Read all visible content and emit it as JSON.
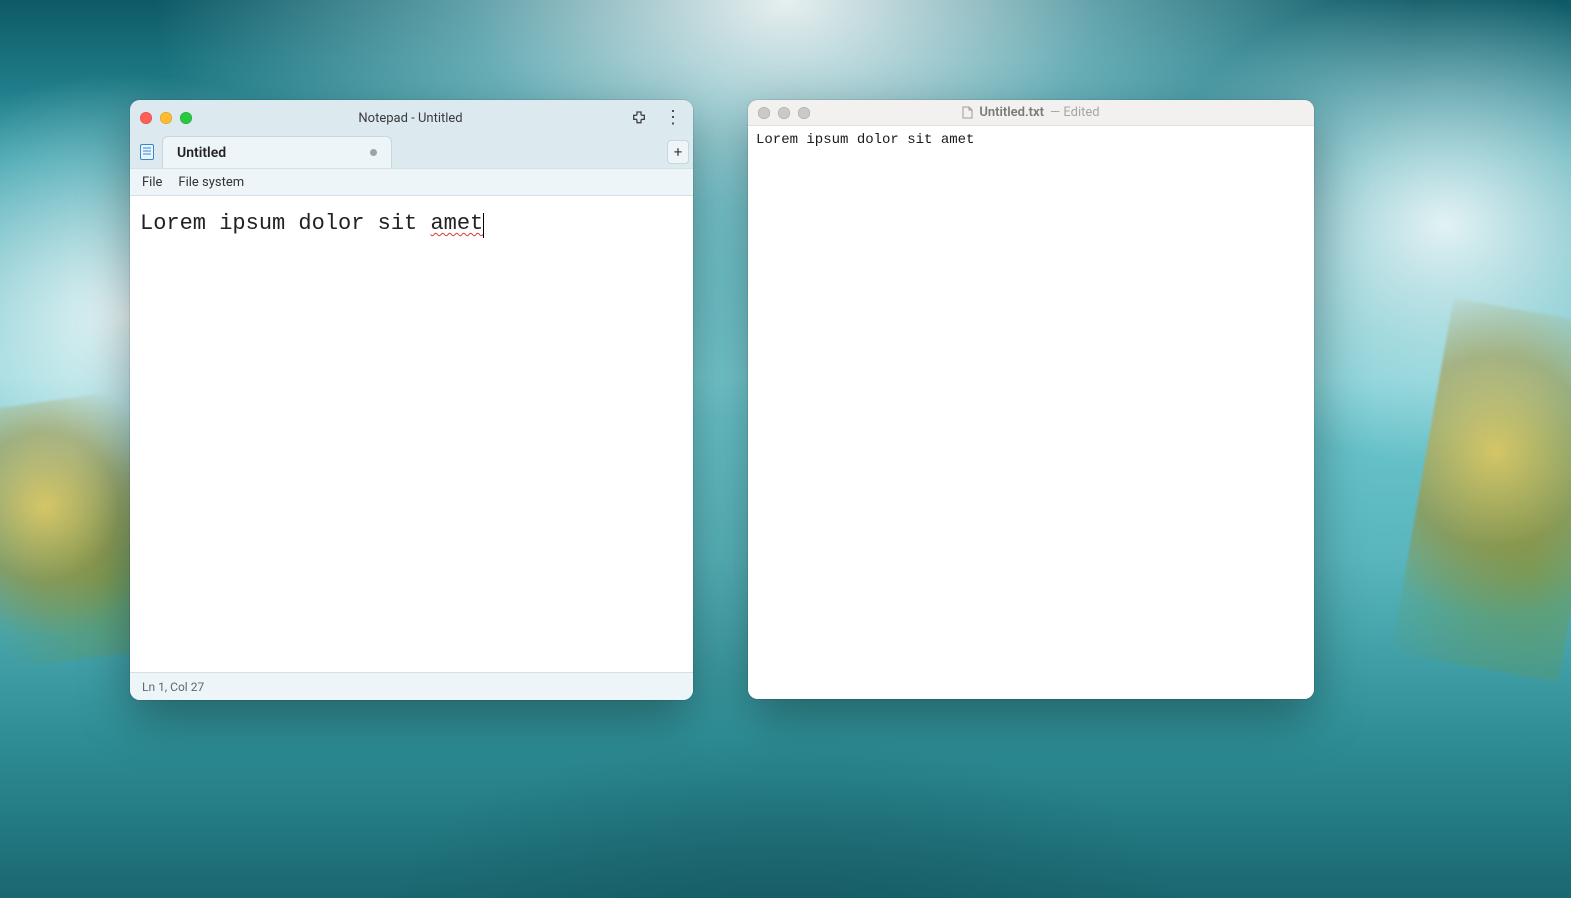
{
  "notepad": {
    "window_title": "Notepad - Untitled",
    "tab": {
      "label": "Untitled",
      "dirty": true
    },
    "menus": {
      "file": "File",
      "file_system": "File system"
    },
    "new_tab_label": "+",
    "editor": {
      "text_prefix": "Lorem ipsum dolor sit ",
      "text_spellerr": "amet"
    },
    "status": "Ln 1, Col 27"
  },
  "textedit": {
    "title_filename": "Untitled.txt",
    "title_suffix": "— Edited",
    "body_text": "Lorem ipsum dolor sit amet"
  }
}
